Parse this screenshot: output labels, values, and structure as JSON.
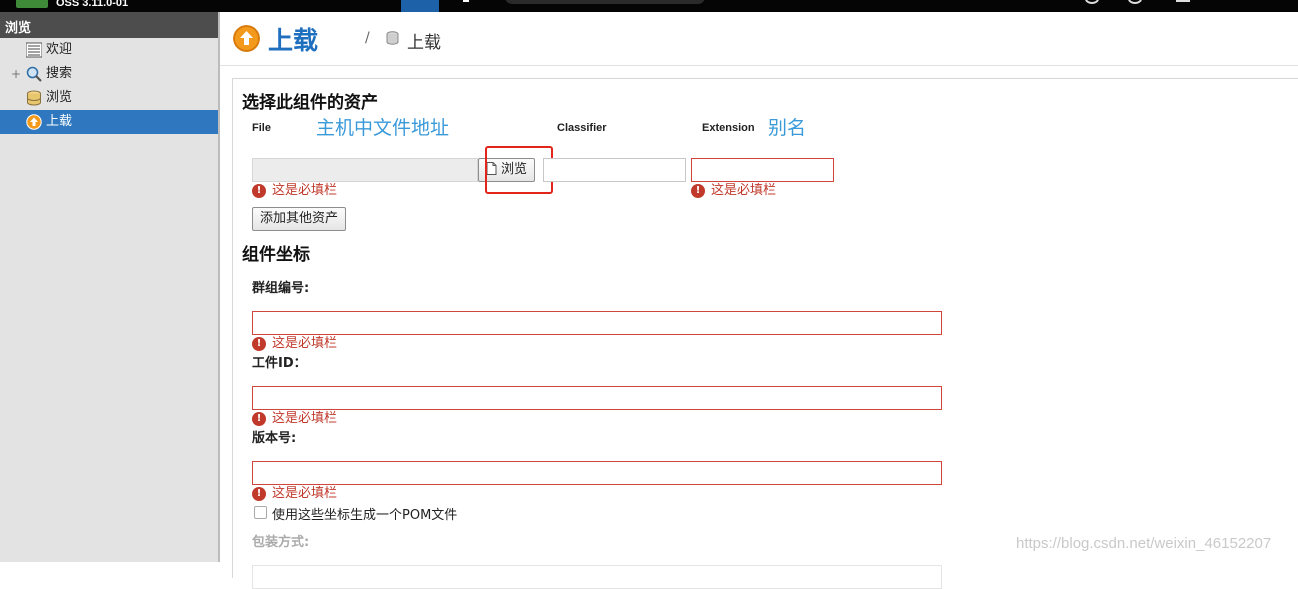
{
  "topbar": {
    "version": "OSS 3.11.0-01"
  },
  "sidebar": {
    "header": "浏览",
    "items": [
      {
        "label": "欢迎",
        "icon": "list-icon"
      },
      {
        "label": "搜索",
        "icon": "search-icon",
        "expand": "+"
      },
      {
        "label": "浏览",
        "icon": "database-icon"
      },
      {
        "label": "上载",
        "icon": "upload-icon",
        "active": true
      }
    ]
  },
  "header": {
    "title": "上载",
    "breadcrumb_sep": "/",
    "breadcrumb_label": "上载"
  },
  "assets": {
    "title": "选择此组件的资产",
    "file_label": "File",
    "file_annotation": "主机中文件地址",
    "browse_label": "浏览",
    "classifier_label": "Classifier",
    "extension_label": "Extension",
    "extension_annotation": "别名",
    "required_msg": "这是必填栏",
    "add_button": "添加其他资产"
  },
  "coordinates": {
    "title": "组件坐标",
    "group_label": "群组编号:",
    "artifact_label": "工件ID：",
    "version_label": "版本号:",
    "required_msg": "这是必填栏",
    "pom_label": "使用这些坐标生成一个POM文件",
    "packaging_label": "包装方式:"
  },
  "watermark": "https://blog.csdn.net/weixin_46152207",
  "colors": {
    "accent": "#1f6fbf",
    "error": "#c0392b",
    "active_nav": "#2f78bf",
    "annotation": "#3a9ad9"
  }
}
